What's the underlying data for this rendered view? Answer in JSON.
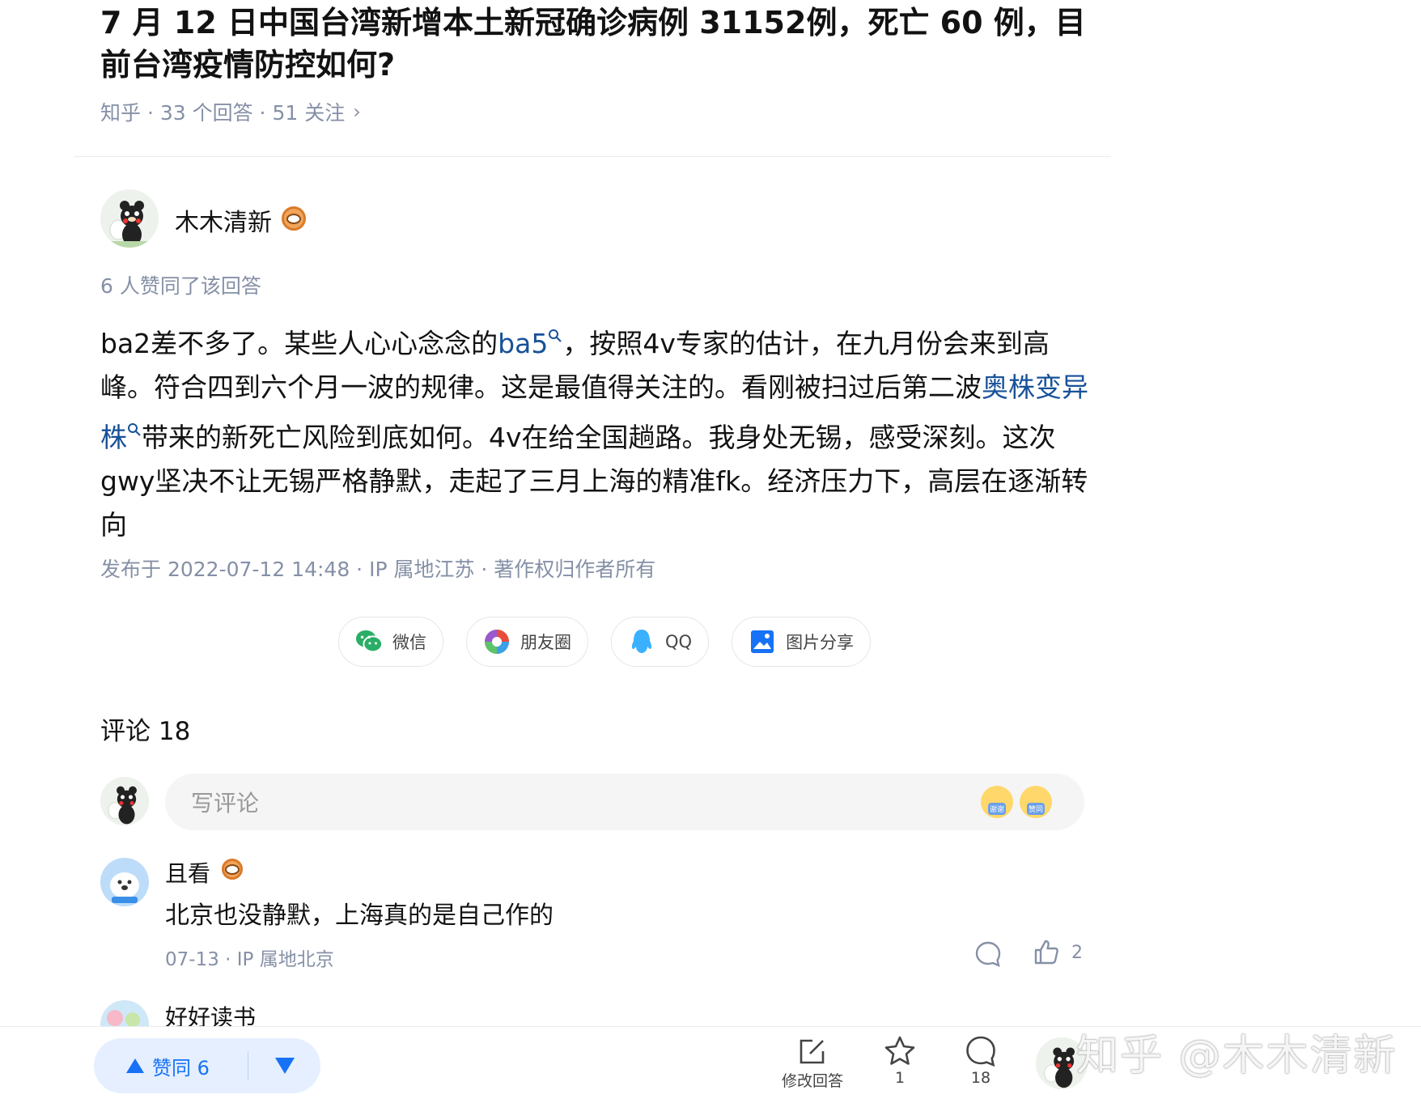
{
  "question": {
    "title": "7 月 12 日中国台湾新增本土新冠确诊病例 31152例，死亡 60 例，目前台湾疫情防控如何?",
    "meta": "知乎 · 33 个回答 · 51 关注",
    "chevron": "›"
  },
  "answer": {
    "author_name": "木木清新",
    "agree_text": "6 人赞同了该回答",
    "content": {
      "p1": "ba2差不多了。某些人心心念念的",
      "kw1": "ba5",
      "p2": "，按照4v专家的估计，在九月份会来到高峰。符合四到六个月一波的规律。这是最值得关注的。看刚被扫过后第二波",
      "kw2": "奥株变异株",
      "p3": "带来的新死亡风险到底如何。4v在给全国趟路。我身处无锡，感受深刻。这次gwy坚决不让无锡严格静默，走起了三月上海的精准fk。经济压力下，高层在逐渐转向"
    },
    "publish_line": "发布于 2022-07-12 14:48 · IP 属地江苏 · 著作权归作者所有"
  },
  "share": {
    "wechat": "微信",
    "moments": "朋友圈",
    "qq": "QQ",
    "image": "图片分享"
  },
  "comments": {
    "title": "评论 18",
    "input_placeholder": "写评论",
    "emoji_thanks": "谢谢",
    "emoji_agree": "赞同",
    "items": [
      {
        "name": "且看",
        "text": "北京也没静默，上海真的是自己作的",
        "meta": "07-13 ·  IP 属地北京",
        "likes": "2"
      },
      {
        "name": "好好读书"
      }
    ]
  },
  "bottom_bar": {
    "vote_label": "赞同 6",
    "edit_label": "修改回答",
    "favorite_count": "1",
    "comment_count": "18"
  },
  "watermark": "知乎 @木木清新",
  "colors": {
    "accent": "#1772f6",
    "link": "#175199",
    "meta_gray": "#8590a6"
  }
}
